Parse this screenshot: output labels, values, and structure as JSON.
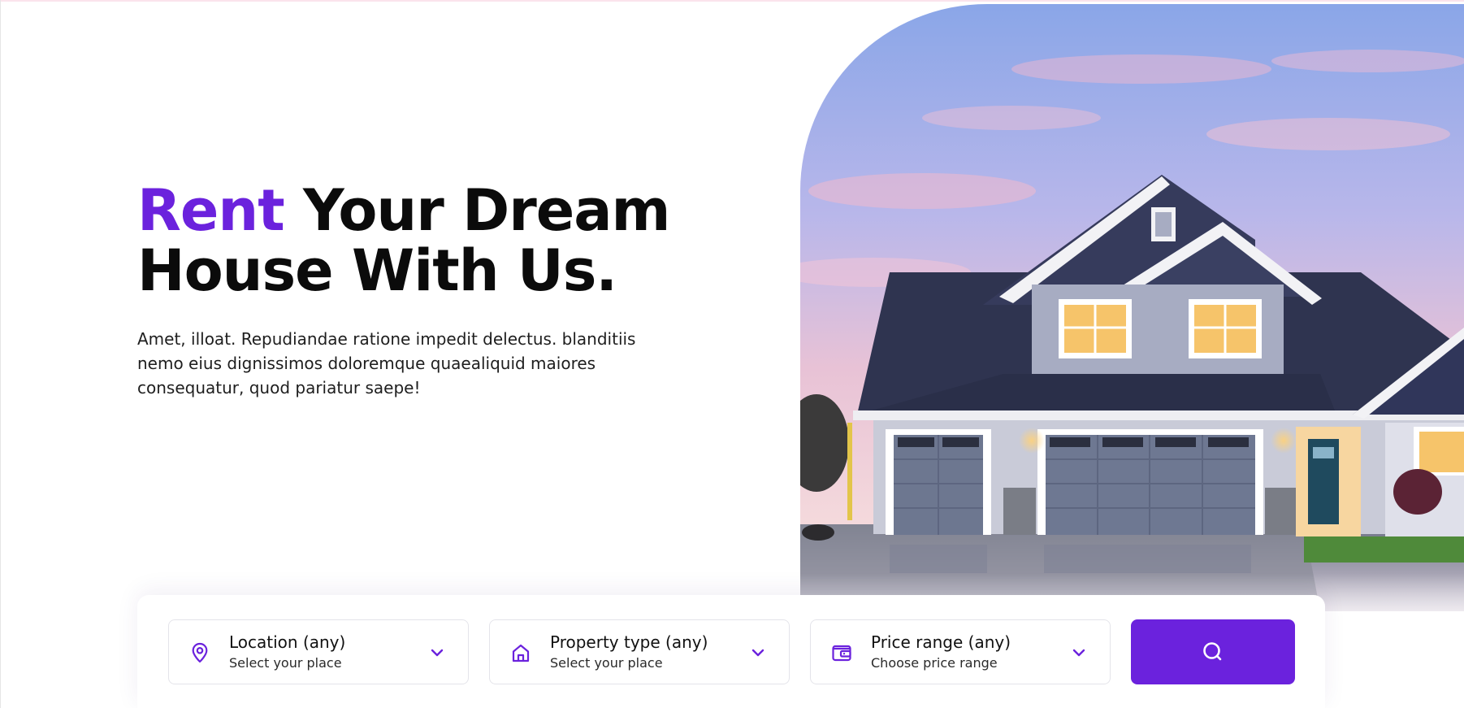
{
  "hero": {
    "title_accent": "Rent",
    "title_line1_rest": " Your Dream",
    "title_line2": "House With Us.",
    "description": "Amet, illoat. Repudiandae ratione impedit delectus. blanditiis nemo eius dignissimos doloremque quaealiquid maiores consequatur, quod pariatur saepe!"
  },
  "search": {
    "location": {
      "title": "Location (any)",
      "subtitle": "Select your place",
      "icon": "map-pin-icon"
    },
    "property_type": {
      "title": "Property type (any)",
      "subtitle": "Select your place",
      "icon": "house-icon"
    },
    "price_range": {
      "title": "Price range (any)",
      "subtitle": "Choose price range",
      "icon": "wallet-icon"
    },
    "button_icon": "search-icon"
  },
  "colors": {
    "accent": "#6b22dd",
    "text": "#0b0b0b"
  }
}
